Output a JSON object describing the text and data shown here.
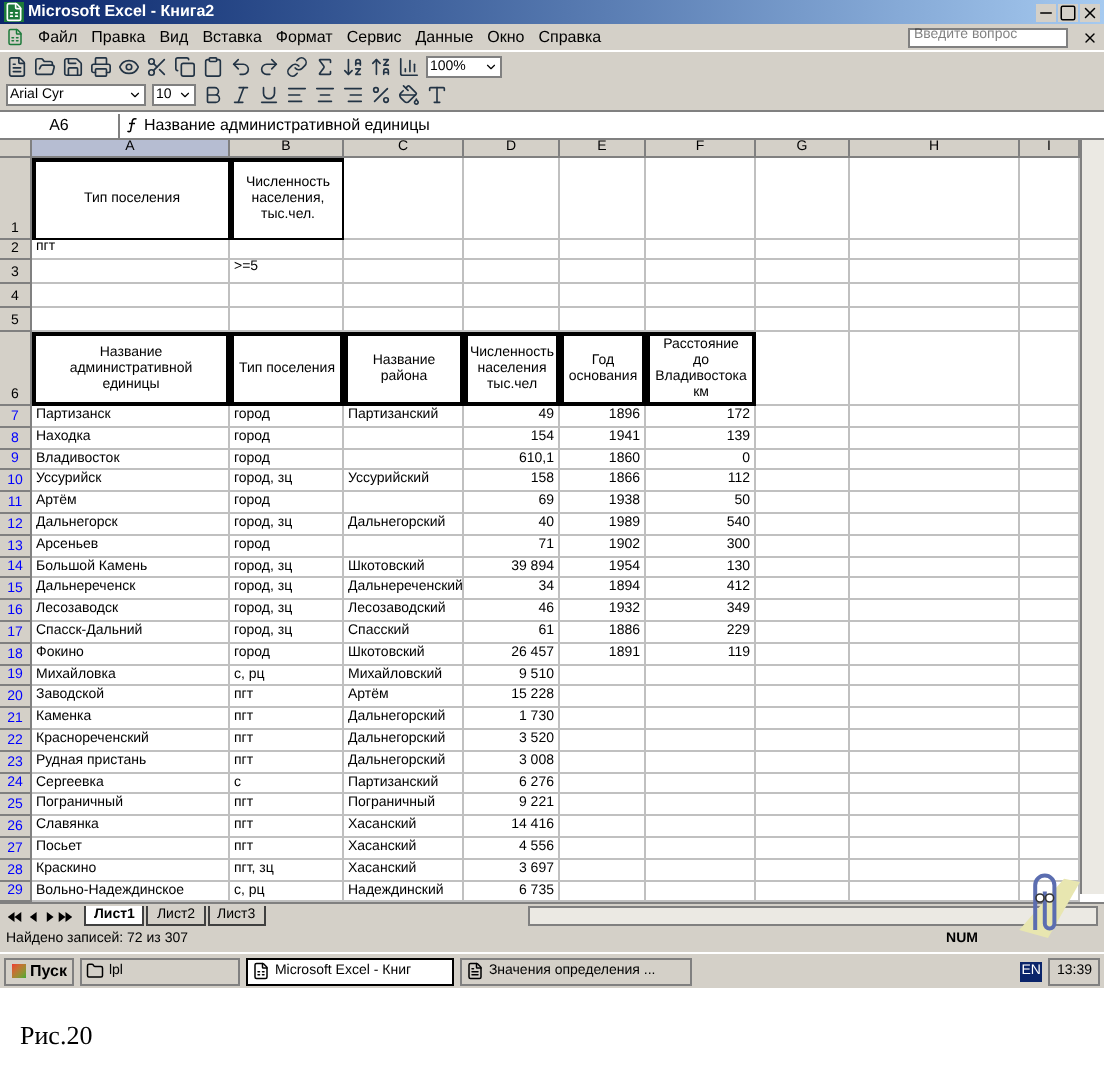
{
  "window": {
    "title": "Microsoft Excel - Книга2"
  },
  "menu": [
    "Файл",
    "Правка",
    "Вид",
    "Вставка",
    "Формат",
    "Сервис",
    "Данные",
    "Окно",
    "Справка"
  ],
  "help_box": {
    "placeholder": "Введите вопрос"
  },
  "toolbar": {
    "zoom": "100%",
    "font": "Arial Cyr",
    "size": "10"
  },
  "formula_bar": {
    "cell": "A6",
    "content": "Название административной единицы"
  },
  "columns": [
    "A",
    "B",
    "C",
    "D",
    "E",
    "F",
    "G",
    "H",
    "I"
  ],
  "criteria": {
    "row_numbers": [
      "1",
      "2",
      "3",
      "4",
      "5"
    ],
    "headers": [
      "Тип поселения",
      "Численность населения, тыс.чел."
    ],
    "type_value": "пгт",
    "population_value": ">=5"
  },
  "table": {
    "row_number": "6",
    "columns": [
      "Название административной единицы",
      "Тип поселения",
      "Название района",
      "Численность населения тыс.чел",
      "Год основания",
      "Расстояние до Владивостока км"
    ],
    "rows": [
      {
        "num": "7",
        "cells": [
          "Партизанск",
          "город",
          "Партизанский",
          "49",
          "1896",
          "172"
        ]
      },
      {
        "num": "8",
        "cells": [
          "Находка",
          "город",
          "",
          "154",
          "1941",
          "139"
        ]
      },
      {
        "num": "9",
        "cells": [
          "Владивосток",
          "город",
          "",
          "610,1",
          "1860",
          "0"
        ]
      },
      {
        "num": "10",
        "cells": [
          "Уссурийск",
          "город, зц",
          "Уссурийский",
          "158",
          "1866",
          "112"
        ]
      },
      {
        "num": "11",
        "cells": [
          "Артём",
          "город",
          "",
          "69",
          "1938",
          "50"
        ]
      },
      {
        "num": "12",
        "cells": [
          "Дальнегорск",
          "город, зц",
          "Дальнегорский",
          "40",
          "1989",
          "540"
        ]
      },
      {
        "num": "13",
        "cells": [
          "Арсеньев",
          "город",
          "",
          "71",
          "1902",
          "300"
        ]
      },
      {
        "num": "14",
        "cells": [
          "Большой Камень",
          "город, зц",
          "Шкотовский",
          "39 894",
          "1954",
          "130"
        ]
      },
      {
        "num": "15",
        "cells": [
          "Дальнереченск",
          "город, зц",
          "Дальнереченский",
          "34",
          "1894",
          "412"
        ]
      },
      {
        "num": "16",
        "cells": [
          "Лесозаводск",
          "город, зц",
          "Лесозаводский",
          "46",
          "1932",
          "349"
        ]
      },
      {
        "num": "17",
        "cells": [
          "Спасск-Дальний",
          "город, зц",
          "Спасский",
          "61",
          "1886",
          "229"
        ]
      },
      {
        "num": "18",
        "cells": [
          "Фокино",
          "город",
          "Шкотовский",
          "26 457",
          "1891",
          "119"
        ]
      },
      {
        "num": "19",
        "cells": [
          "Михайловка",
          "с, рц",
          "Михайловский",
          "9 510",
          "",
          ""
        ]
      },
      {
        "num": "20",
        "cells": [
          "Заводской",
          "пгт",
          "Артём",
          "15 228",
          "",
          ""
        ]
      },
      {
        "num": "21",
        "cells": [
          "Каменка",
          "пгт",
          "Дальнегорский",
          "1 730",
          "",
          ""
        ]
      },
      {
        "num": "22",
        "cells": [
          "Краснореченский",
          "пгт",
          "Дальнегорский",
          "3 520",
          "",
          ""
        ]
      },
      {
        "num": "23",
        "cells": [
          "Рудная пристань",
          "пгт",
          "Дальнегорский",
          "3 008",
          "",
          ""
        ]
      },
      {
        "num": "24",
        "cells": [
          "Сергеевка",
          "с",
          "Партизанский",
          "6 276",
          "",
          ""
        ]
      },
      {
        "num": "25",
        "cells": [
          "Пограничный",
          "пгт",
          "Пограничный",
          "9 221",
          "",
          ""
        ]
      },
      {
        "num": "26",
        "cells": [
          "Славянка",
          "пгт",
          "Хасанский",
          "14 416",
          "",
          ""
        ]
      },
      {
        "num": "27",
        "cells": [
          "Посьет",
          "пгт",
          "Хасанский",
          "4 556",
          "",
          ""
        ]
      },
      {
        "num": "28",
        "cells": [
          "Краскино",
          "пгт, зц",
          "Хасанский",
          "3 697",
          "",
          ""
        ]
      },
      {
        "num": "29",
        "cells": [
          "Вольно-Надеждинское",
          "с, рц",
          "Надеждинский",
          "6 735",
          "",
          ""
        ]
      }
    ]
  },
  "sheet_tabs": [
    {
      "label": "Лист1",
      "selected": true
    },
    {
      "label": "Лист2",
      "selected": false
    },
    {
      "label": "Лист3",
      "selected": false
    }
  ],
  "status_bar": {
    "text": "Найдено записей: 72 из 307",
    "indicator": "NUM"
  },
  "taskbar": {
    "start": "Пуск",
    "items": [
      {
        "label": "lpl",
        "kind": "folder",
        "selected": false
      },
      {
        "label": "Microsoft Excel - Книг",
        "kind": "excel",
        "selected": true
      },
      {
        "label": "Значения определения ...",
        "kind": "doc",
        "selected": false
      }
    ],
    "language": "EN",
    "clock": "13:39"
  },
  "caption": "Рис.20"
}
